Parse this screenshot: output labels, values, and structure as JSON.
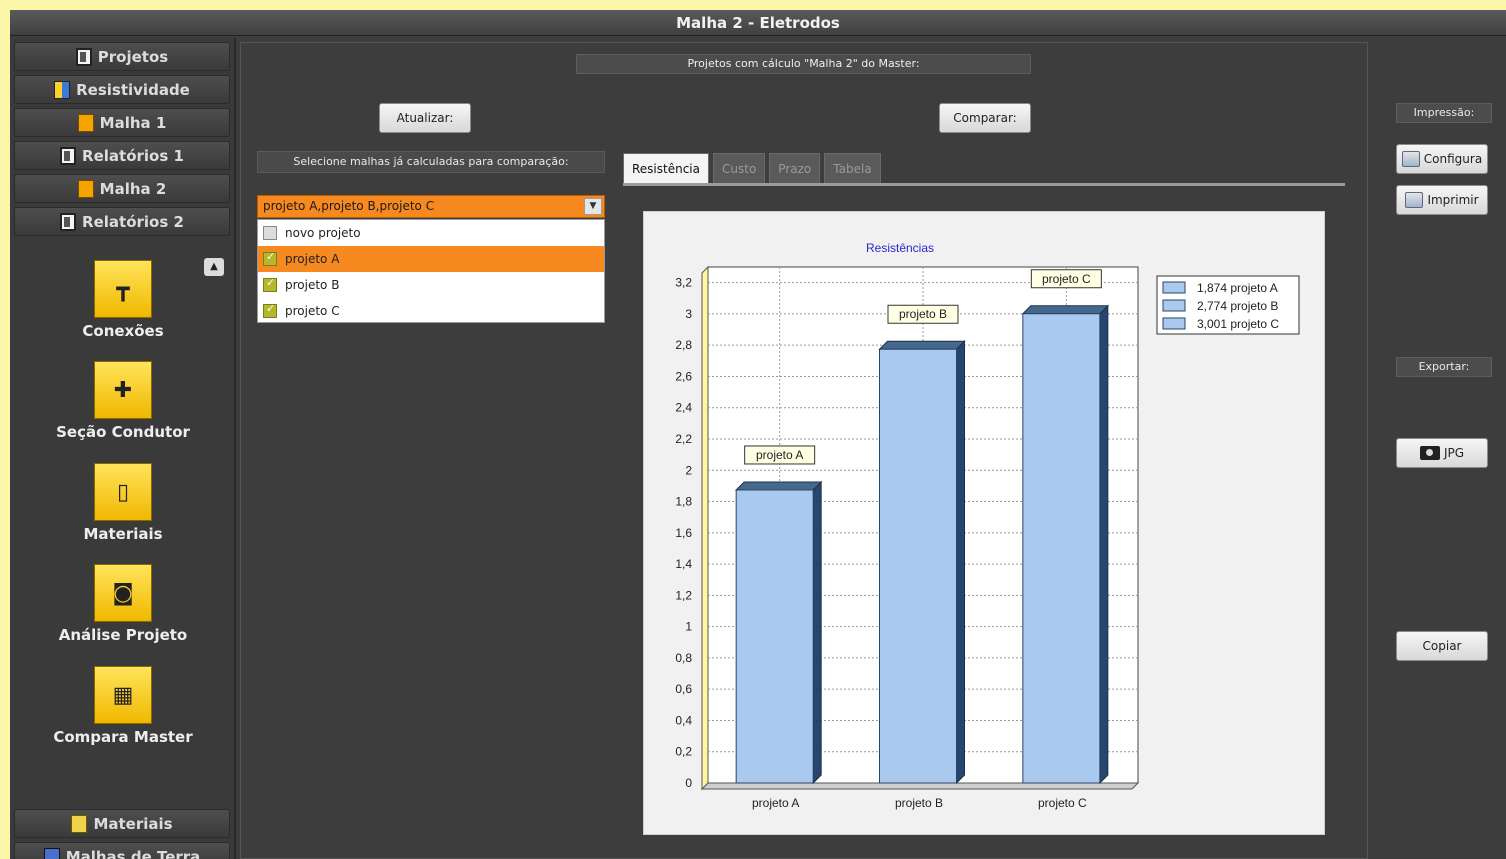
{
  "window": {
    "title": "Malha 2 - Eletrodos"
  },
  "sidebar": {
    "nav": [
      {
        "label": "Projetos",
        "icon": "document-icon"
      },
      {
        "label": "Resistividade",
        "icon": "resistivity-icon"
      },
      {
        "label": "Malha 1",
        "icon": "mesh-icon"
      },
      {
        "label": "Relatórios 1",
        "icon": "document-icon"
      },
      {
        "label": "Malha 2",
        "icon": "mesh-icon"
      },
      {
        "label": "Relatórios 2",
        "icon": "document-icon"
      }
    ],
    "tools": [
      {
        "label": "Conexões",
        "icon": "connections-icon"
      },
      {
        "label": "Seção Condutor",
        "icon": "conductor-section-icon"
      },
      {
        "label": "Materiais",
        "icon": "materials-icon"
      },
      {
        "label": "Análise Projeto",
        "icon": "project-analysis-icon"
      },
      {
        "label": "Compara Master",
        "icon": "compare-master-icon"
      }
    ],
    "bottom": [
      {
        "label": "Materiais",
        "icon": "materials-icon"
      },
      {
        "label": "Malhas de Terra",
        "icon": "ground-mesh-icon"
      }
    ]
  },
  "main": {
    "heading": "Projetos com cálculo \"Malha 2\" do Master:",
    "update_button": "Atualizar:",
    "compare_button": "Comparar:",
    "select_label": "Selecione malhas já calculadas para comparação:",
    "combo_value": "projeto A,projeto B,projeto C",
    "dropdown_items": [
      {
        "label": "novo projeto",
        "checked": false,
        "selected": false
      },
      {
        "label": "projeto A",
        "checked": true,
        "selected": true
      },
      {
        "label": "projeto B",
        "checked": true,
        "selected": false
      },
      {
        "label": "projeto C",
        "checked": true,
        "selected": false
      }
    ],
    "tabs": [
      "Resistência",
      "Custo",
      "Prazo",
      "Tabela"
    ],
    "active_tab": "Resistência"
  },
  "chart_data": {
    "type": "bar",
    "title": "Resistências",
    "categories": [
      "projeto A",
      "projeto B",
      "projeto C"
    ],
    "values": [
      1.874,
      2.774,
      3.001
    ],
    "ylim": [
      0,
      3.3
    ],
    "yticks": [
      "0",
      "0,2",
      "0,4",
      "0,6",
      "0,8",
      "1",
      "1,2",
      "1,4",
      "1,6",
      "1,8",
      "2",
      "2,2",
      "2,4",
      "2,6",
      "2,8",
      "3",
      "3,2"
    ],
    "bar_labels": [
      "projeto A",
      "projeto B",
      "projeto C"
    ],
    "legend": [
      "1,874 projeto A",
      "2,774 projeto B",
      "3,001 projeto C"
    ],
    "legend_position": "top-right",
    "grid": true,
    "colors": {
      "bar_face": "#a9c9ee",
      "bar_side": "#26466e",
      "bar_top": "#46688f",
      "title": "#2828c8",
      "axis_wall": "#fff7a0"
    }
  },
  "right_panel": {
    "print_label": "Impressão:",
    "config_button": "Configura",
    "print_button": "Imprimir",
    "export_label": "Exportar:",
    "jpg_button": "JPG",
    "copy_button": "Copiar"
  }
}
